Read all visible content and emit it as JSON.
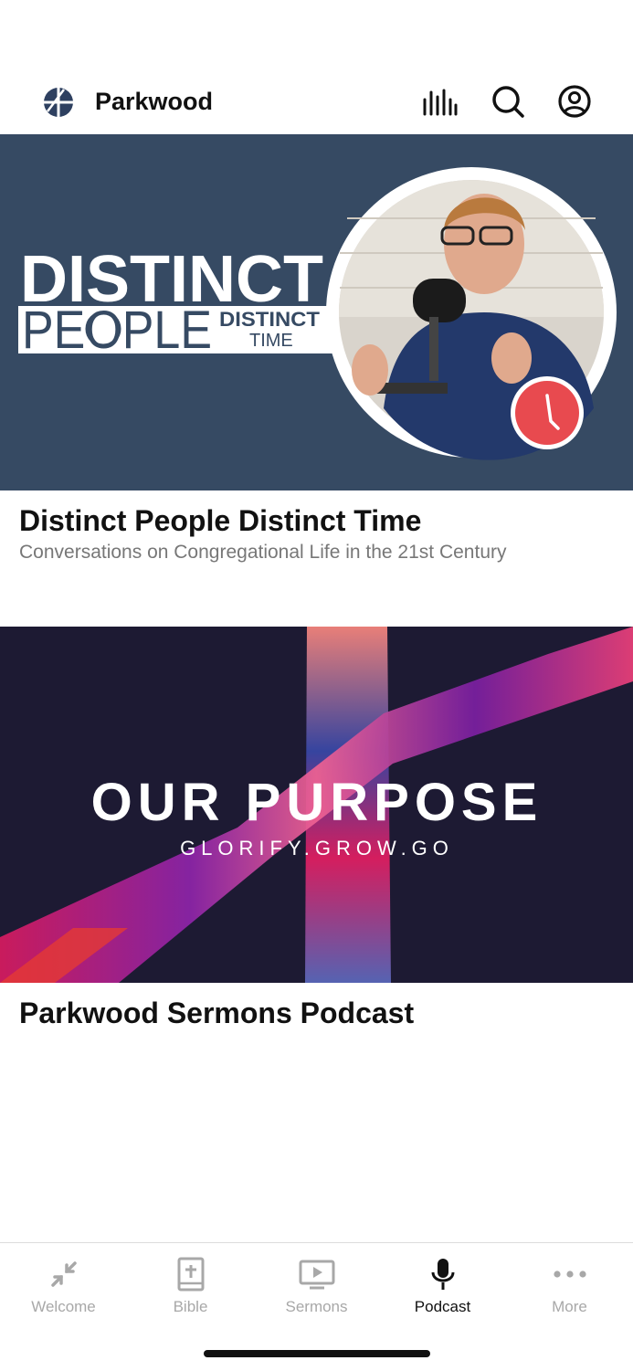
{
  "header": {
    "app_name": "Parkwood",
    "logo_icon": "parkwood-logo",
    "actions": [
      {
        "icon": "audio-levels-icon"
      },
      {
        "icon": "search-icon"
      },
      {
        "icon": "account-icon"
      }
    ]
  },
  "podcasts": [
    {
      "title": "Distinct People Distinct Time",
      "subtitle": "Conversations on Congregational Life in the 21st Century",
      "artwork": {
        "line1": "DISTINCT",
        "line2": "PEOPLE",
        "line3a": "DISTINCT",
        "line3b": "TIME",
        "background": "#364a63",
        "badge_color": "#e84a4f"
      }
    },
    {
      "title": "Parkwood Sermons Podcast",
      "artwork": {
        "headline": "OUR PURPOSE",
        "tagline": "GLORIFY.GROW.GO",
        "background": "#1d1a33"
      }
    }
  ],
  "tabbar": {
    "tabs": [
      {
        "label": "Welcome",
        "icon": "welcome-icon"
      },
      {
        "label": "Bible",
        "icon": "bible-icon"
      },
      {
        "label": "Sermons",
        "icon": "sermons-icon"
      },
      {
        "label": "Podcast",
        "icon": "microphone-icon"
      },
      {
        "label": "More",
        "icon": "more-icon"
      }
    ],
    "active": "Podcast",
    "active_color": "#111111",
    "inactive_color": "#a8a8a8"
  }
}
